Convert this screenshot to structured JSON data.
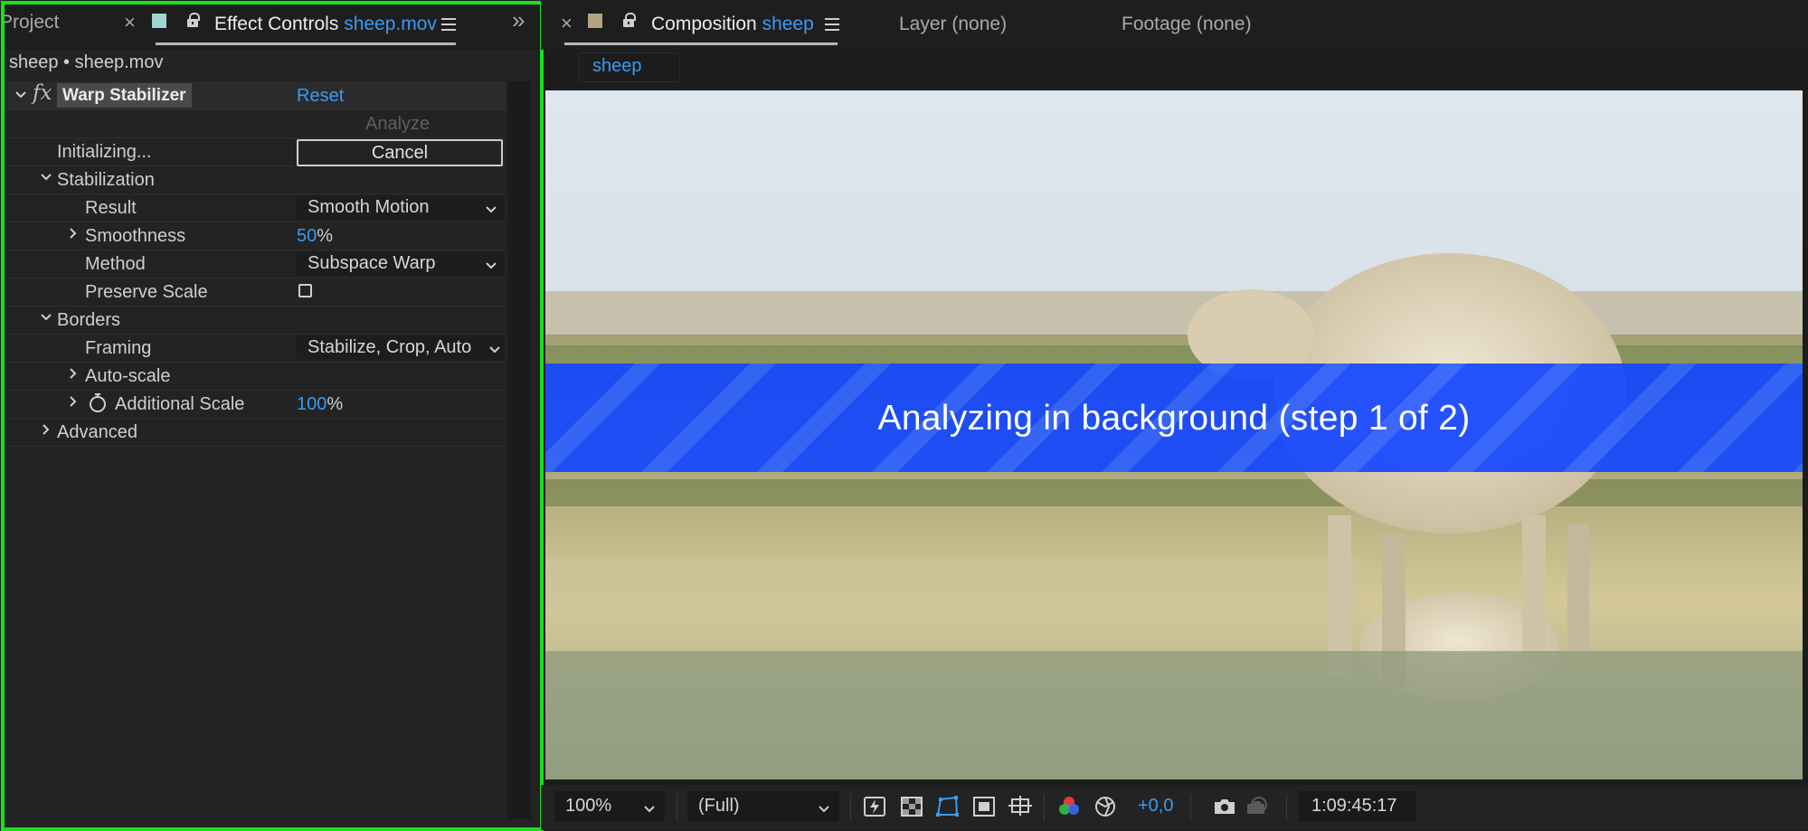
{
  "left_panel": {
    "tabs": {
      "project_label": "Project",
      "close_glyph": "×",
      "effect_controls_label": "Effect Controls",
      "effect_controls_file": "sheep.mov",
      "overflow_glyph": "»"
    },
    "layer_path": "sheep • sheep.mov",
    "effect": {
      "fx_glyph": "fx",
      "name": "Warp Stabilizer",
      "reset_label": "Reset",
      "analyze_label": "Analyze",
      "status_text": "Initializing...",
      "cancel_label": "Cancel",
      "stabilization_label": "Stabilization",
      "result_label": "Result",
      "result_value": "Smooth Motion",
      "smoothness_label": "Smoothness",
      "smoothness_value": "50",
      "smoothness_unit": "%",
      "method_label": "Method",
      "method_value": "Subspace Warp",
      "preserve_scale_label": "Preserve Scale",
      "preserve_scale_checked": false,
      "borders_label": "Borders",
      "framing_label": "Framing",
      "framing_value": "Stabilize, Crop, Auto",
      "auto_scale_label": "Auto-scale",
      "additional_scale_label": "Additional Scale",
      "additional_scale_value": "100",
      "additional_scale_unit": "%",
      "advanced_label": "Advanced"
    }
  },
  "right_panel": {
    "tabs": {
      "close_glyph": "×",
      "composition_label": "Composition",
      "composition_name": "sheep",
      "layer_label": "Layer (none)",
      "footage_label": "Footage (none)"
    },
    "comp_chip": "sheep",
    "banner_text": "Analyzing in background (step 1 of 2)",
    "toolbar": {
      "zoom_value": "100%",
      "resolution_value": "(Full)",
      "exposure_value": "+0,0",
      "timecode": "1:09:45:17"
    }
  },
  "colors": {
    "accent_blue": "#3a9bf2",
    "highlight_frame": "#17e31a",
    "banner_blue": "#1446ff"
  },
  "icons": [
    "close-icon",
    "color-swatch-icon",
    "lock-icon",
    "hamburger-menu-icon",
    "panel-overflow-icon",
    "fx-icon",
    "chevron-down-icon",
    "chevron-right-icon",
    "stopwatch-icon",
    "fast-previews-icon",
    "transparency-grid-icon",
    "mask-path-visibility-icon",
    "region-of-interest-icon",
    "guides-options-icon",
    "color-channels-icon",
    "exposure-reset-icon",
    "snapshot-camera-icon",
    "show-snapshot-icon"
  ]
}
